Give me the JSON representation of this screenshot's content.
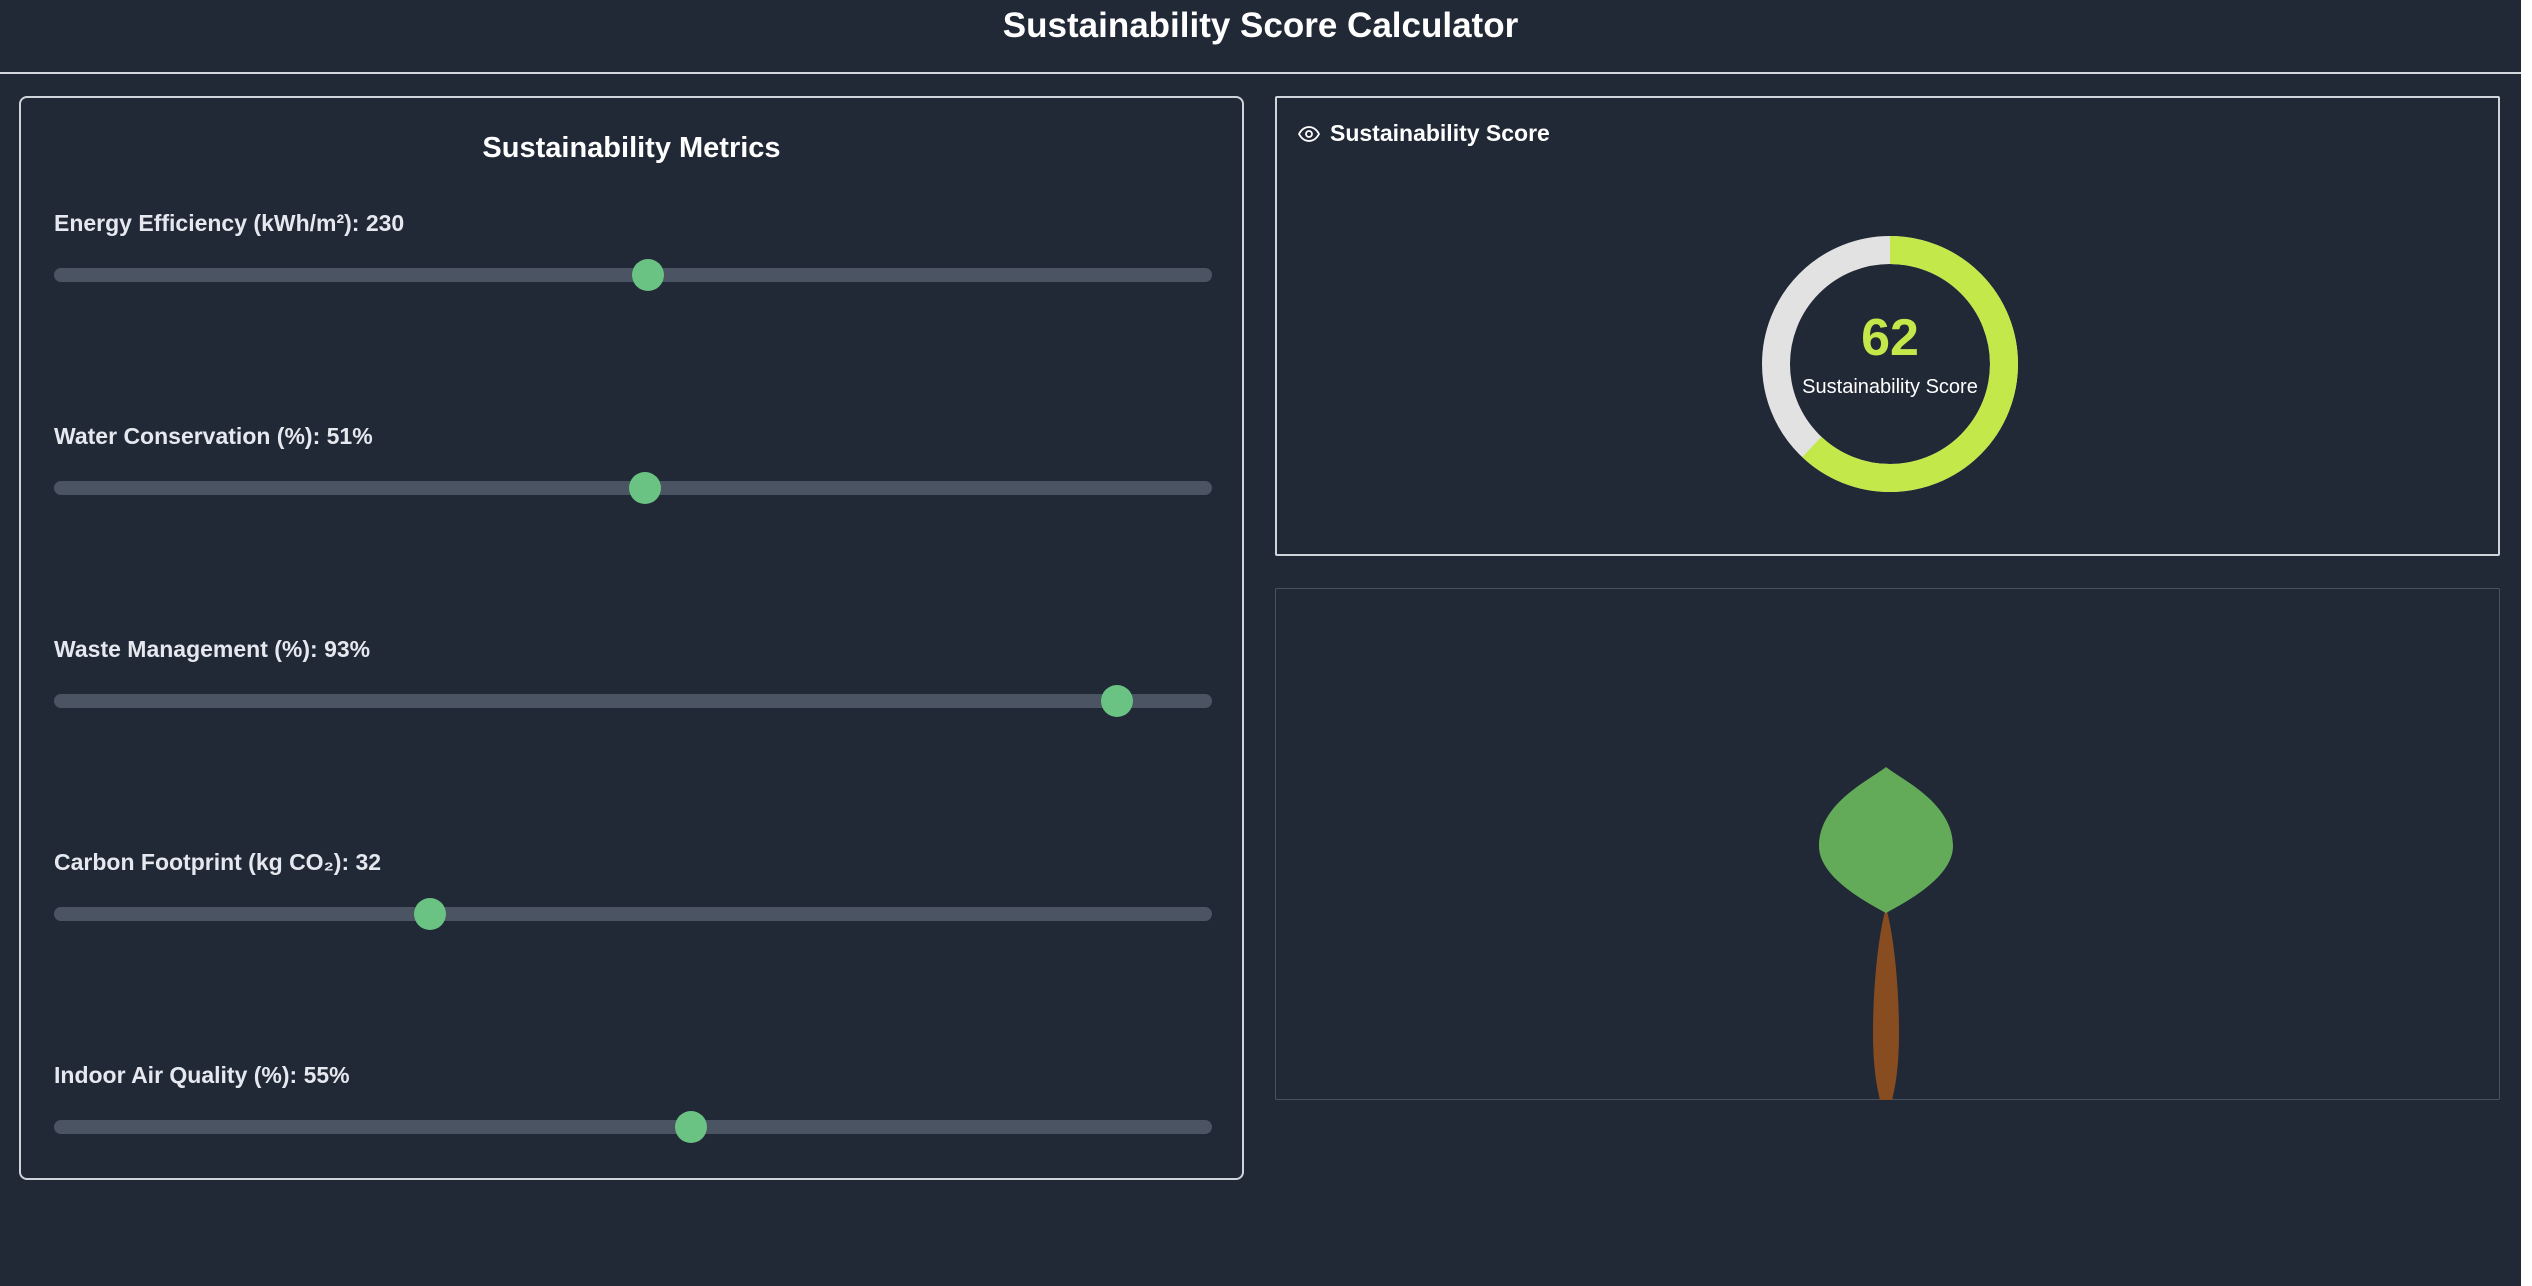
{
  "header": {
    "title": "Sustainability Score Calculator"
  },
  "metrics": {
    "title": "Sustainability Metrics",
    "items": [
      {
        "label": "Energy Efficiency (kWh/m²): 230",
        "value_fraction": 0.513
      },
      {
        "label": "Water Conservation (%): 51%",
        "value_fraction": 0.51
      },
      {
        "label": "Waste Management (%): 93%",
        "value_fraction": 0.918
      },
      {
        "label": "Carbon Footprint (kg CO₂): 32",
        "value_fraction": 0.325
      },
      {
        "label": "Indoor Air Quality (%): 55%",
        "value_fraction": 0.55
      }
    ]
  },
  "score": {
    "heading": "Sustainability Score",
    "value": "62",
    "caption": "Sustainability Score",
    "fraction": 0.62
  },
  "colors": {
    "background": "#212836",
    "gauge_fill": "#c3e84a",
    "gauge_track": "#e2e2e2",
    "slider_thumb": "#6ac283",
    "leaf": "#63ab58",
    "trunk": "#874d20"
  },
  "icons": {
    "score_header_icon": "eye-icon"
  }
}
